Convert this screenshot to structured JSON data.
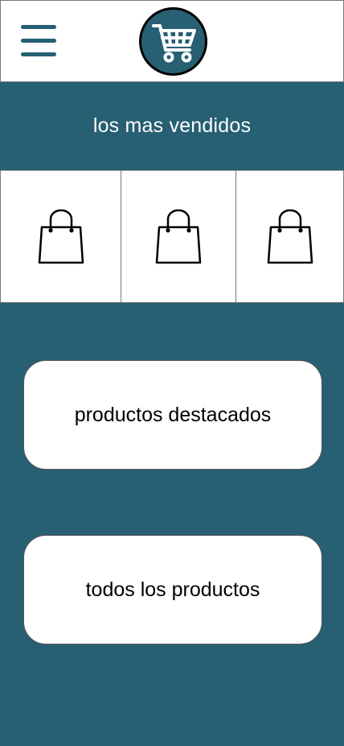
{
  "header": {
    "menu_icon": "hamburger-menu-icon",
    "logo_icon": "shopping-cart-icon"
  },
  "banner": {
    "title": "los mas vendidos"
  },
  "bestsellers": {
    "items": [
      {
        "icon": "shopping-bag-icon"
      },
      {
        "icon": "shopping-bag-icon"
      },
      {
        "icon": "shopping-bag-icon"
      }
    ]
  },
  "actions": {
    "featured_label": "productos destacados",
    "all_label": "todos los productos"
  },
  "colors": {
    "primary": "#275f73",
    "surface": "#ffffff",
    "text": "#000000"
  }
}
